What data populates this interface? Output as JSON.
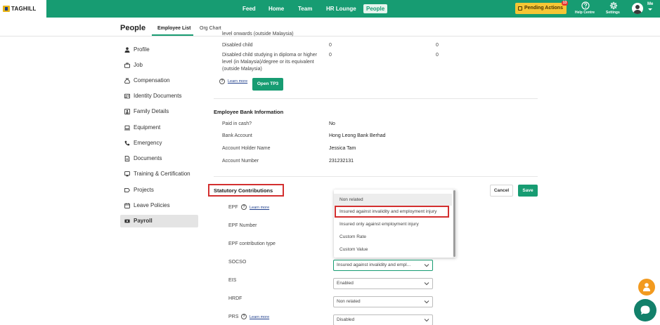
{
  "brand": {
    "logo_text": "TAGHILL"
  },
  "topnav": {
    "items": [
      "Feed",
      "Home",
      "Team",
      "HR Lounge",
      "People"
    ],
    "active": "People",
    "pending_label": "Pending Actions",
    "pending_count": "13",
    "help_label": "Help Centre",
    "settings_label": "Settings",
    "me_label": "Me"
  },
  "subheader": {
    "title": "People",
    "tabs": [
      "Employee List",
      "Org Chart"
    ],
    "active_tab": "Employee List"
  },
  "sidebar": {
    "items": [
      {
        "label": "Profile",
        "icon": "person-icon"
      },
      {
        "label": "Job",
        "icon": "briefcase-icon"
      },
      {
        "label": "Compensation",
        "icon": "money-bag-icon"
      },
      {
        "label": "Identity Documents",
        "icon": "id-card-icon"
      },
      {
        "label": "Family Details",
        "icon": "family-icon"
      },
      {
        "label": "Equipment",
        "icon": "laptop-icon"
      },
      {
        "label": "Emergency",
        "icon": "phone-icon"
      },
      {
        "label": "Documents",
        "icon": "document-icon"
      },
      {
        "label": "Training & Certification",
        "icon": "certificate-icon"
      },
      {
        "label": "Projects",
        "icon": "projects-icon"
      },
      {
        "label": "Leave Policies",
        "icon": "leave-icon"
      },
      {
        "label": "Payroll",
        "icon": "payroll-icon"
      }
    ],
    "active": "Payroll"
  },
  "tax_relief": {
    "cut_row_label": "level onwards (outside Malaysia)",
    "rows": [
      {
        "label": "Disabled child",
        "value1": "0",
        "value2": "0"
      },
      {
        "label_lines": [
          "Disabled child studying in diploma or higher",
          "level (in Malaysia)/degree or its equivalent",
          "(outside Malaysia)"
        ],
        "value1": "0",
        "value2": "0"
      }
    ],
    "learn_more": "Learn more",
    "open_tp3": "Open TP3"
  },
  "bank": {
    "title": "Employee Bank Information",
    "rows": [
      {
        "label": "Paid in cash?",
        "value": "No"
      },
      {
        "label": "Bank Account",
        "value": "Hong Leong Bank Berhad"
      },
      {
        "label": "Account Holder Name",
        "value": "Jessica Tam"
      },
      {
        "label": "Account Number",
        "value": "231232131"
      }
    ]
  },
  "statutory": {
    "title": "Statutory Contributions",
    "cancel": "Cancel",
    "save": "Save",
    "fields": [
      {
        "label": "EPF",
        "learn_more": "Learn more"
      },
      {
        "label": "EPF Number"
      },
      {
        "label": "EPF contribution type"
      },
      {
        "label": "SOCSO",
        "value": "Insured against invalidity and empl..."
      },
      {
        "label": "EIS",
        "value": "Enabled"
      },
      {
        "label": "HRDF",
        "value": "Non related"
      },
      {
        "label": "PRS",
        "learn_more": "Learn more",
        "value": "Disabled"
      }
    ],
    "dropdown_options": [
      "Non related",
      "Insured against invalidity and employment injury",
      "Insured only against employment injury",
      "Custom Rate",
      "Custom Value"
    ],
    "highlighted_option": "Insured against invalidity and employment injury"
  },
  "colors": {
    "brand_green": "#179c72",
    "pending_yellow": "#f6c635",
    "highlight_red": "#d32f2f",
    "fab_orange": "#f29a1f",
    "chat_green": "#12806a"
  }
}
